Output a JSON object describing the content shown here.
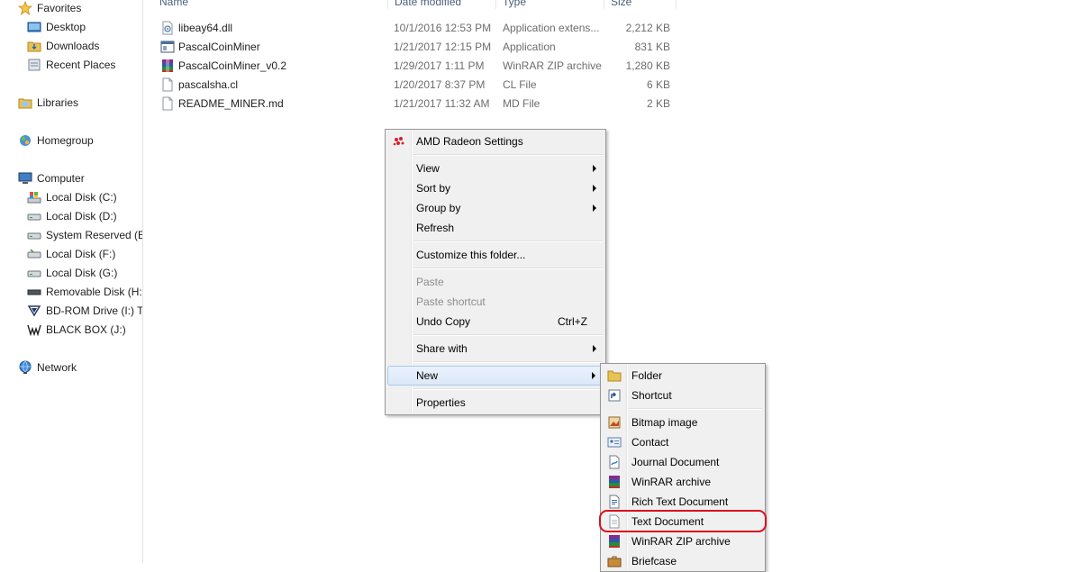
{
  "nav": {
    "favorites": "Favorites",
    "desktop": "Desktop",
    "downloads": "Downloads",
    "recent_places": "Recent Places",
    "libraries": "Libraries",
    "homegroup": "Homegroup",
    "computer": "Computer",
    "drives": [
      "Local Disk (C:)",
      "Local Disk (D:)",
      "System Reserved (E:)",
      "Local Disk (F:)",
      "Local Disk (G:)",
      "Removable Disk (H:)",
      "BD-ROM Drive (I:) TI",
      "BLACK BOX (J:)"
    ],
    "network": "Network"
  },
  "columns": {
    "name": "Name",
    "date": "Date modified",
    "type": "Type",
    "size": "Size"
  },
  "files": [
    {
      "name": "libeay64.dll",
      "date": "10/1/2016 12:53 PM",
      "type": "Application extens...",
      "size": "2,212 KB",
      "icon": "dll-icon"
    },
    {
      "name": "PascalCoinMiner",
      "date": "1/21/2017 12:15 PM",
      "type": "Application",
      "size": "831 KB",
      "icon": "application-icon"
    },
    {
      "name": "PascalCoinMiner_v0.2",
      "date": "1/29/2017 1:11 PM",
      "type": "WinRAR ZIP archive",
      "size": "1,280 KB",
      "icon": "winrar-icon"
    },
    {
      "name": "pascalsha.cl",
      "date": "1/20/2017 8:37 PM",
      "type": "CL File",
      "size": "6 KB",
      "icon": "file-icon"
    },
    {
      "name": "README_MINER.md",
      "date": "1/21/2017 11:32 AM",
      "type": "MD File",
      "size": "2 KB",
      "icon": "file-icon"
    }
  ],
  "context_menu": {
    "amd": "AMD Radeon Settings",
    "view": "View",
    "sort_by": "Sort by",
    "group_by": "Group by",
    "refresh": "Refresh",
    "customize": "Customize this folder...",
    "paste": "Paste",
    "paste_shortcut": "Paste shortcut",
    "undo_copy": "Undo Copy",
    "undo_shortcut": "Ctrl+Z",
    "share_with": "Share with",
    "new": "New",
    "properties": "Properties"
  },
  "new_submenu": {
    "folder": "Folder",
    "shortcut": "Shortcut",
    "bitmap": "Bitmap image",
    "contact": "Contact",
    "journal": "Journal Document",
    "winrar": "WinRAR archive",
    "rtf": "Rich Text Document",
    "text": "Text Document",
    "winrar_zip": "WinRAR ZIP archive",
    "briefcase": "Briefcase"
  },
  "colors": {
    "highlight_ring": "#d8101c",
    "menu_bg": "#f0f0f0",
    "selection": "#dbe8f8"
  }
}
